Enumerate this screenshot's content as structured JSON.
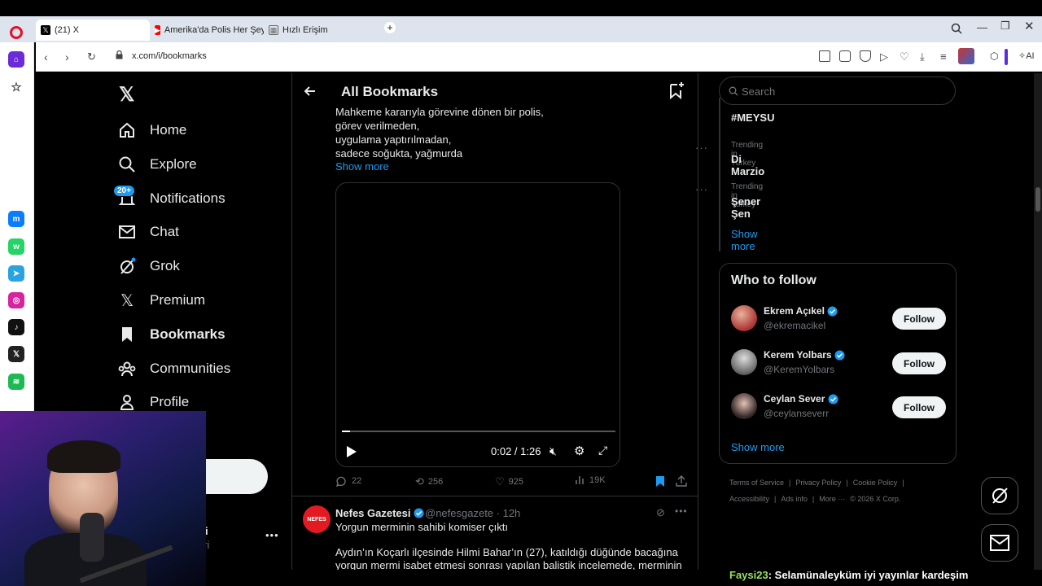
{
  "browser": {
    "tabs": [
      {
        "title": "(21) X",
        "active": true
      },
      {
        "title": "Amerika'da Polis Her Şeyi",
        "active": false
      },
      {
        "title": "Hızlı Erişim",
        "active": false
      }
    ],
    "new_tab": "+",
    "url": "x.com/i/bookmarks",
    "ai_label": "AI"
  },
  "x_nav": {
    "items": [
      {
        "label": "Home",
        "icon": "home-icon"
      },
      {
        "label": "Explore",
        "icon": "search-icon"
      },
      {
        "label": "Notifications",
        "icon": "bell-icon"
      },
      {
        "label": "Chat",
        "icon": "mail-icon"
      },
      {
        "label": "Grok",
        "icon": "grok-icon"
      },
      {
        "label": "Premium",
        "icon": "x-icon"
      },
      {
        "label": "Bookmarks",
        "icon": "bookmark-icon"
      },
      {
        "label": "Communities",
        "icon": "communities-icon"
      },
      {
        "label": "Profile",
        "icon": "person-icon"
      }
    ],
    "notifications_badge": "20+",
    "account_fragment_1": "i",
    "account_fragment_2": "ri"
  },
  "main": {
    "title": "All Bookmarks",
    "tweet1": {
      "lines": [
        "Mahkeme kararıyla görevine dönen bir polis,",
        "görev verilmeden,",
        "uygulama yaptırılmadan,",
        "sadece soğukta, yağmurda"
      ],
      "show_more": "Show more",
      "video_time": "0:02 / 1:26",
      "video_progress": 0.03,
      "replies": "22",
      "reposts": "256",
      "likes": "925",
      "views": "19K"
    },
    "tweet2": {
      "avatar_text": "NEFES",
      "name": "Nefes Gazetesi",
      "handle": "@nefesgazete · 12h",
      "headline": "Yorgun merminin sahibi komiser çıktı",
      "body1": "Aydın’ın Koçarlı ilçesinde Hilmi Bahar’ın (27), katıldığı düğünde bacağına",
      "body2": "yorgun mermi isabet etmesi sonrası yapılan balistik incelemede, merminin"
    }
  },
  "right": {
    "search_placeholder": "Search",
    "trends": [
      {
        "meta": "",
        "name": "#MEYSU"
      },
      {
        "meta": "Trending in Turkey",
        "name": "Di Marzio"
      },
      {
        "meta": "Trending in Turkey",
        "name": "Şener Şen"
      }
    ],
    "trends_show_more": "Show more",
    "who_to_follow": {
      "title": "Who to follow",
      "users": [
        {
          "name": "Ekrem Açıkel",
          "handle": "@ekremacikel",
          "button": "Follow"
        },
        {
          "name": "Kerem Yolbars",
          "handle": "@KeremYolbars",
          "button": "Follow"
        },
        {
          "name": "Ceylan Sever",
          "handle": "@ceylanseverr",
          "button": "Follow"
        }
      ],
      "show_more": "Show more"
    },
    "footer_row1": [
      "Terms of Service",
      "|",
      "Privacy Policy",
      "|",
      "Cookie Policy",
      "|"
    ],
    "footer_row2": [
      "Accessibility",
      "|",
      "Ads info",
      "|",
      "More ···",
      "© 2026 X Corp."
    ]
  },
  "overlay": {
    "chat_user": "Faysi23",
    "chat_message": ": Selamünaleyküm iyi yayınlar kardeşim"
  },
  "colors": {
    "accent": "#1d9bf0",
    "text": "#e7e9ea",
    "muted": "#71767b",
    "border": "#2f3336",
    "chat_user": "#9be15d"
  }
}
